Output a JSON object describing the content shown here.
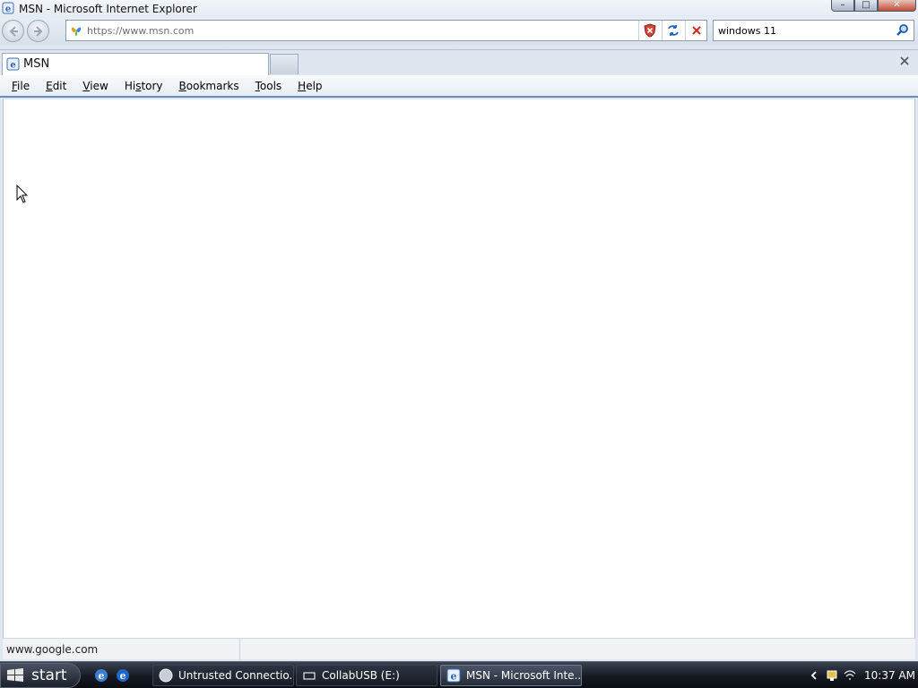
{
  "window": {
    "title": "MSN - Microsoft Internet Explorer",
    "controls": {
      "minimize": "–",
      "maximize": "□",
      "close": "✕"
    }
  },
  "navigation": {
    "address_value": "https://www.msn.com",
    "search_value": "windows 11"
  },
  "tabs": [
    {
      "label": "MSN",
      "active": true
    }
  ],
  "menu": [
    {
      "label": "File",
      "accel": "F"
    },
    {
      "label": "Edit",
      "accel": "E"
    },
    {
      "label": "View",
      "accel": "V"
    },
    {
      "label": "History",
      "accel": "s"
    },
    {
      "label": "Bookmarks",
      "accel": "B"
    },
    {
      "label": "Tools",
      "accel": "T"
    },
    {
      "label": "Help",
      "accel": "H"
    }
  ],
  "status": {
    "text": "www.google.com"
  },
  "taskbar": {
    "start_label": "start",
    "tasks": [
      {
        "label": "Untrusted Connectio...",
        "active": false
      },
      {
        "label": "CollabUSB (E:)",
        "active": false
      },
      {
        "label": "MSN - Microsoft Inte...",
        "active": true
      }
    ],
    "clock": "10:37 AM"
  },
  "colors": {
    "accent": "#6b8cb8",
    "stop_red": "#d42a1e",
    "refresh_blue": "#1b5fc4",
    "taskbar_dark": "#151a22"
  },
  "icons": {
    "app": "ie-icon",
    "site": "msn-butterfly-icon",
    "security": "shield-warning-icon",
    "refresh": "refresh-icon",
    "stop": "stop-icon",
    "search": "search-icon"
  }
}
